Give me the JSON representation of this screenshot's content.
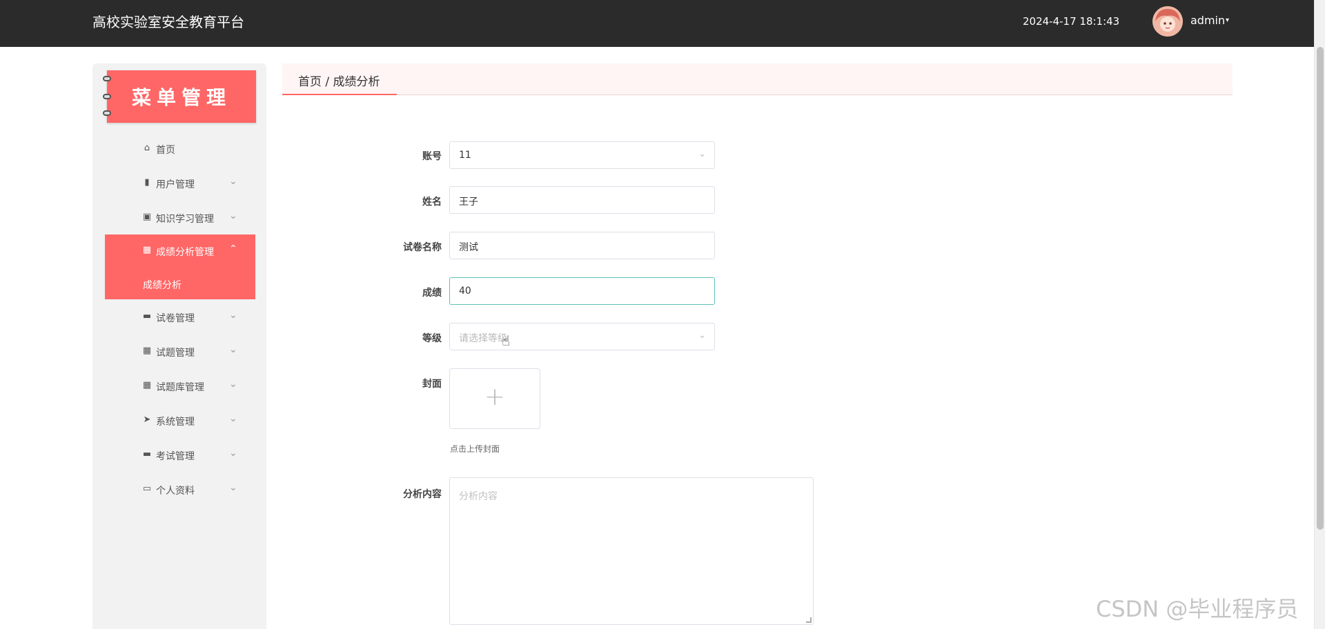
{
  "header": {
    "title": "高校实验室安全教育平台",
    "datetime": "2024-4-17 18:1:43",
    "user": "admin",
    "caret": "▾"
  },
  "sidebar": {
    "banner": "菜单管理",
    "items": [
      {
        "label": "首页",
        "icon": "⌂",
        "icon_name": "home-icon",
        "arrow": ""
      },
      {
        "label": "用户管理",
        "icon": "▮",
        "icon_name": "user-icon",
        "arrow": "⌄"
      },
      {
        "label": "知识学习管理",
        "icon": "▣",
        "icon_name": "clipboard-icon",
        "arrow": "⌄"
      },
      {
        "label": "成绩分析管理",
        "icon": "▦",
        "icon_name": "grid-icon",
        "arrow": "⌃"
      },
      {
        "label": "试卷管理",
        "icon": "▬",
        "icon_name": "monitor-icon",
        "arrow": "⌄"
      },
      {
        "label": "试题管理",
        "icon": "▦",
        "icon_name": "grid-icon",
        "arrow": "⌄"
      },
      {
        "label": "试题库管理",
        "icon": "▦",
        "icon_name": "grid-icon",
        "arrow": "⌄"
      },
      {
        "label": "系统管理",
        "icon": "➤",
        "icon_name": "send-icon",
        "arrow": "⌄"
      },
      {
        "label": "考试管理",
        "icon": "▬",
        "icon_name": "monitor-icon",
        "arrow": "⌄"
      },
      {
        "label": "个人资料",
        "icon": "▭",
        "icon_name": "card-icon",
        "arrow": "⌄"
      }
    ],
    "active_sub": "成绩分析"
  },
  "breadcrumb": "首页 / 成绩分析",
  "form": {
    "account_label": "账号",
    "account_value": "11",
    "name_label": "姓名",
    "name_value": "王子",
    "paper_label": "试卷名称",
    "paper_value": "测试",
    "score_label": "成绩",
    "score_value": "40",
    "level_label": "等级",
    "level_placeholder": "请选择等级",
    "cover_label": "封面",
    "upload_plus": "+",
    "cover_hint": "点击上传封面",
    "analysis_label": "分析内容",
    "analysis_placeholder": "分析内容"
  },
  "watermark": "CSDN @毕业程序员",
  "colors": {
    "accent": "#ff6666",
    "header_bg": "#2b2b2b",
    "focus": "#5cc2b6"
  }
}
